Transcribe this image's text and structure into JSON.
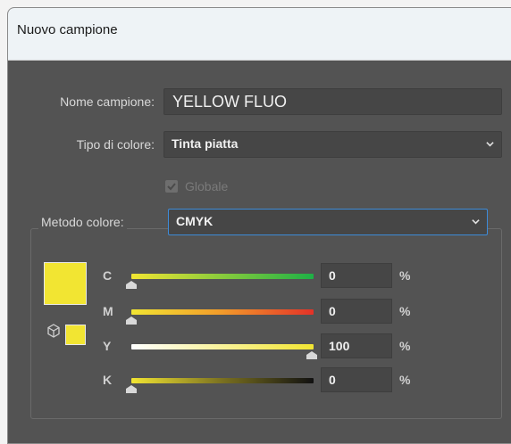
{
  "window": {
    "title": "Nuovo campione"
  },
  "form": {
    "name_label": "Nome campione:",
    "name_value": "YELLOW FLUO",
    "type_label": "Tipo di colore:",
    "type_value": "Tinta piatta",
    "global_label": "Globale",
    "global_checked": true,
    "method_label": "Metodo colore:",
    "method_value": "CMYK"
  },
  "swatch": {
    "color": "#f2e532"
  },
  "channels": [
    {
      "label": "C",
      "value": "0",
      "unit": "%",
      "gradient_end": "#1eb046"
    },
    {
      "label": "M",
      "value": "0",
      "unit": "%",
      "gradient_end": "#e33228"
    },
    {
      "label": "Y",
      "value": "100",
      "unit": "%",
      "gradient_start": "#ffffff",
      "gradient_end": "#f2e532"
    },
    {
      "label": "K",
      "value": "0",
      "unit": "%",
      "gradient_end": "#111111"
    }
  ],
  "colors": {
    "accent": "#3d8bd8",
    "panel": "#535353"
  }
}
